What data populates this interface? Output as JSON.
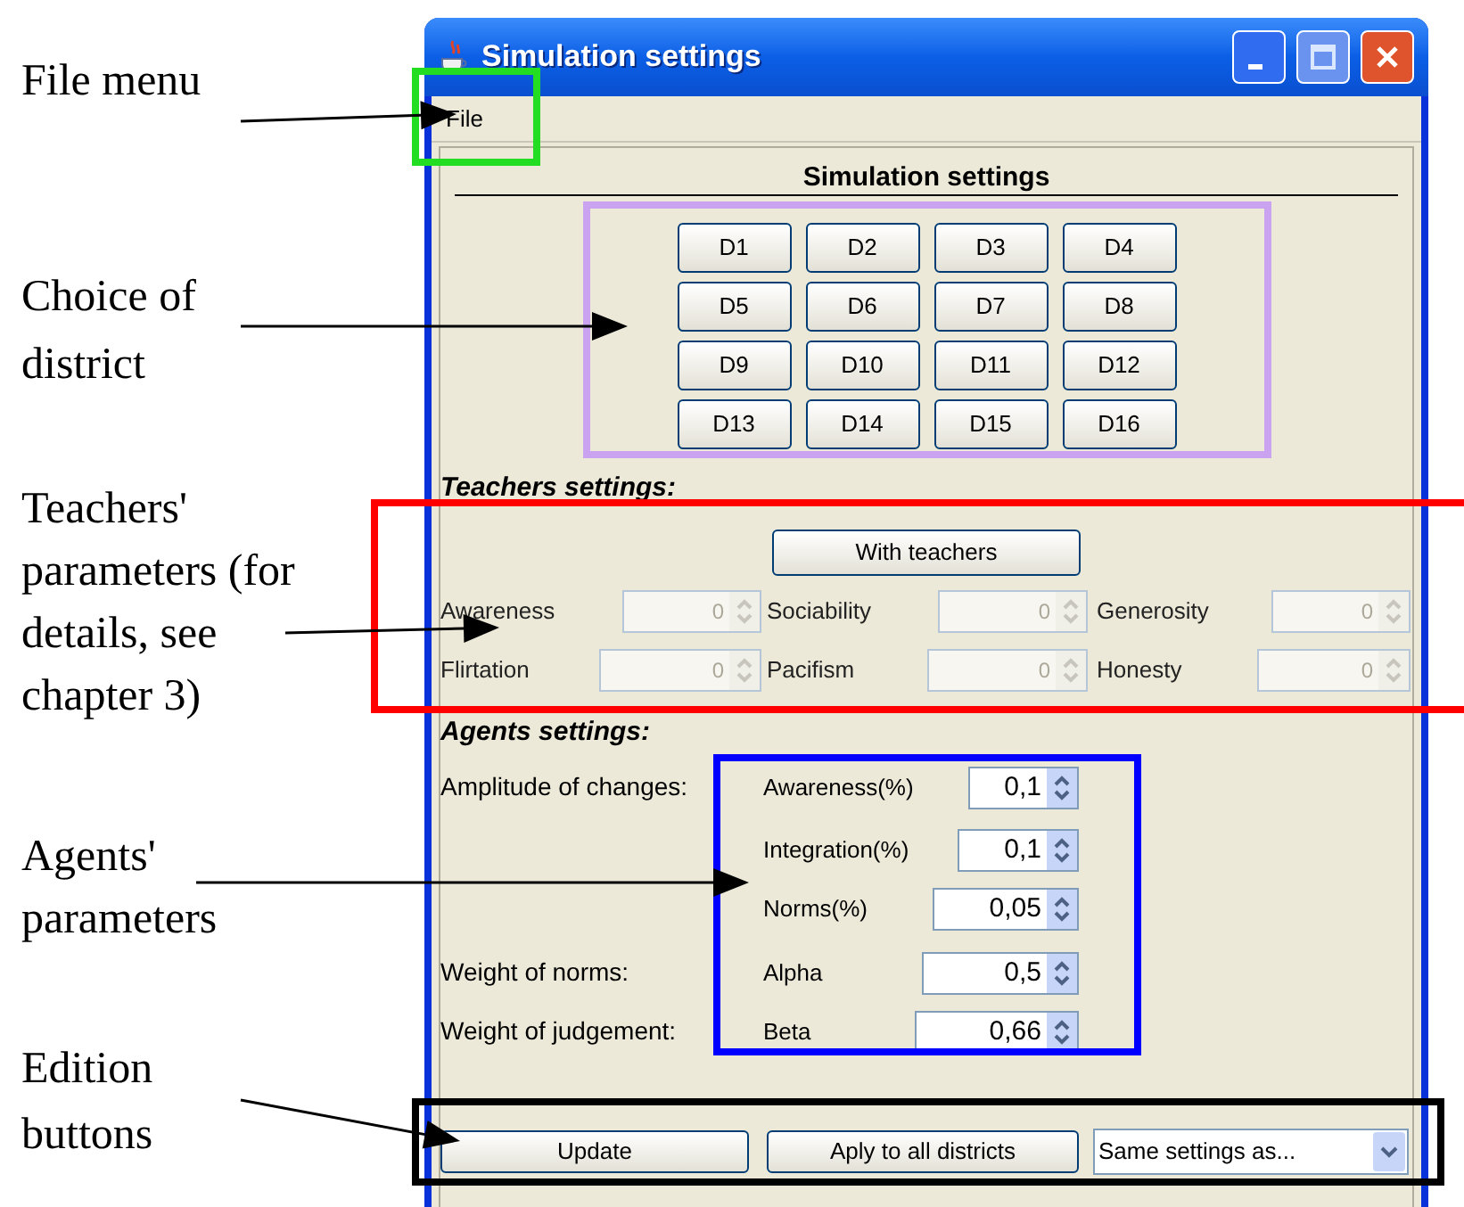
{
  "annotations": [
    {
      "lines": [
        "File menu"
      ],
      "color": "#22dd22"
    },
    {
      "lines": [
        "Choice of",
        "district"
      ],
      "color": "#c9a3f0"
    },
    {
      "lines": [
        "Teachers'",
        "parameters (for",
        "details, see",
        "chapter 3)"
      ],
      "color": "#ff0000"
    },
    {
      "lines": [
        "Agents'",
        "parameters"
      ],
      "color": "#0000ff"
    },
    {
      "lines": [
        "Edition",
        "buttons"
      ],
      "color": "#000000"
    }
  ],
  "window": {
    "title": "Simulation settings",
    "menu": [
      "File"
    ],
    "heading": "Simulation settings",
    "districts": [
      "D1",
      "D2",
      "D3",
      "D4",
      "D5",
      "D6",
      "D7",
      "D8",
      "D9",
      "D10",
      "D11",
      "D12",
      "D13",
      "D14",
      "D15",
      "D16"
    ],
    "teachers": {
      "heading": "Teachers settings:",
      "toggle": "With teachers",
      "fields": [
        {
          "label": "Awareness",
          "value": "0",
          "disabled": true
        },
        {
          "label": "Sociability",
          "value": "0",
          "disabled": true
        },
        {
          "label": "Generosity",
          "value": "0",
          "disabled": true
        },
        {
          "label": "Flirtation",
          "value": "0",
          "disabled": true
        },
        {
          "label": "Pacifism",
          "value": "0",
          "disabled": true
        },
        {
          "label": "Honesty",
          "value": "0",
          "disabled": true
        }
      ]
    },
    "agents": {
      "heading": "Agents settings:",
      "rows": [
        {
          "group_label": "Amplitude of changes:",
          "label": "Awareness(%)",
          "value": "0,1"
        },
        {
          "label": "Integration(%)",
          "value": "0,1"
        },
        {
          "label": "Norms(%)",
          "value": "0,05"
        },
        {
          "group_label": "Weight of norms:",
          "label": "Alpha",
          "value": "0,5"
        },
        {
          "group_label": "Weight of judgement:",
          "label": "Beta",
          "value": "0,66"
        }
      ]
    },
    "buttons": [
      "Update",
      "Aply to all districts"
    ],
    "dropdown": {
      "value": "Same settings as..."
    }
  }
}
